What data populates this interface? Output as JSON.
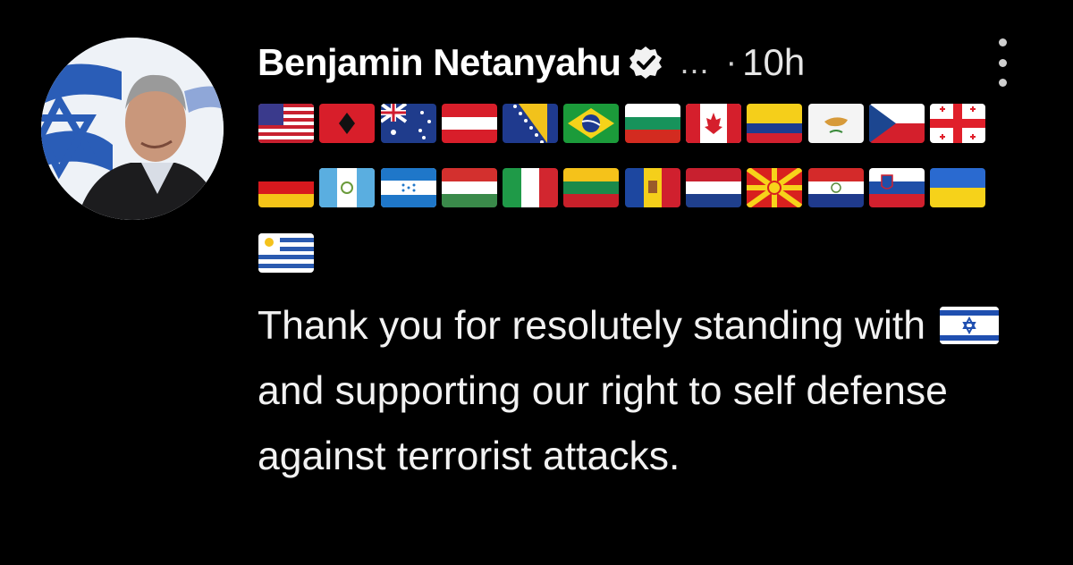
{
  "post": {
    "author_name": "Benjamin Netanyahu",
    "overflow_ellipsis": "...",
    "separator": "·",
    "timestamp": "10h",
    "text_before_flag": "Thank you for resolutely standing with",
    "text_after_flag": "and supporting our right to self defense against terrorist attacks."
  },
  "flags": {
    "row1": [
      "us-flag-icon",
      "albania-flag-icon",
      "australia-flag-icon",
      "austria-flag-icon",
      "bosnia-flag-icon",
      "brazil-flag-icon",
      "bulgaria-flag-icon",
      "canada-flag-icon",
      "colombia-flag-icon",
      "cyprus-flag-icon",
      "czechia-flag-icon",
      "georgia-flag-icon"
    ],
    "row2": [
      "germany-flag-icon",
      "guatemala-flag-icon",
      "honduras-flag-icon",
      "hungary-flag-icon",
      "italy-flag-icon",
      "lithuania-flag-icon",
      "moldova-flag-icon",
      "netherlands-flag-icon",
      "north-macedonia-flag-icon",
      "paraguay-flag-icon",
      "slovenia-flag-icon",
      "ukraine-flag-icon"
    ],
    "row3": [
      "uruguay-flag-icon"
    ],
    "inline": "israel-flag-icon"
  },
  "colors": {
    "background": "#000000",
    "text": "#f2f2f2",
    "muted": "#cfcfcf"
  }
}
